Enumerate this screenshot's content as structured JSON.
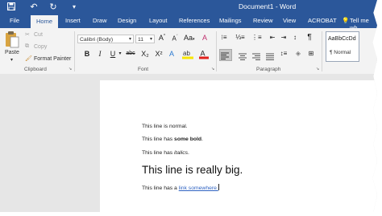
{
  "window": {
    "title": "Document1 - Word",
    "icons": [
      "save-icon",
      "undo-icon",
      "redo-icon",
      "customize-qat-icon"
    ]
  },
  "tabs": [
    "File",
    "Home",
    "Insert",
    "Draw",
    "Design",
    "Layout",
    "References",
    "Mailings",
    "Review",
    "View",
    "ACROBAT"
  ],
  "tell_me": "Tell me wh",
  "clipboard": {
    "paste": "Paste",
    "cut": "Cut",
    "copy": "Copy",
    "format_painter": "Format Painter",
    "label": "Clipboard"
  },
  "font": {
    "name": "Calibri (Body)",
    "size": "11",
    "label": "Font",
    "buttons": [
      "B",
      "I",
      "U",
      "abc",
      "X₂",
      "X²"
    ]
  },
  "paragraph": {
    "label": "Paragraph"
  },
  "styles": {
    "preview": "AaBbCcDd",
    "name": "¶ Normal"
  },
  "document": {
    "line1": "This line is normal.",
    "line2_pre": "This line has ",
    "line2_bold": "some bold",
    "line2_post": ".",
    "line3_pre": "This line has ",
    "line3_italic": "italics",
    "line3_post": ".",
    "line4": "This line is really big.",
    "line5_pre": "This line has a ",
    "line5_link": "link somewhere."
  },
  "colors": {
    "brand": "#2b579a",
    "link": "#2f63c2",
    "highlight": "#f7e600",
    "font_color": "#e0201b"
  }
}
